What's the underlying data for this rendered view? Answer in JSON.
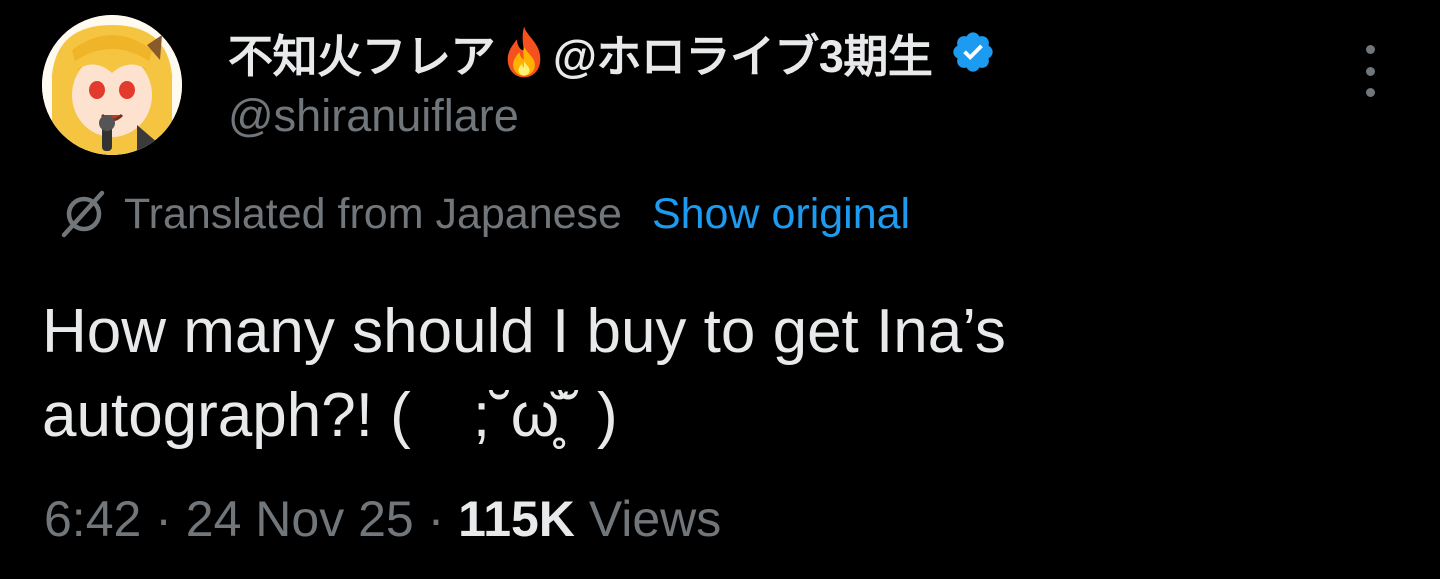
{
  "author": {
    "display_name": "不知火フレア",
    "display_name_suffix": "@ホロライブ3期生",
    "handle": "@shiranuiflare",
    "emoji_icon": "fire-icon",
    "verified_icon": "verified-badge-icon"
  },
  "translation": {
    "notice": "Translated from Japanese",
    "show_original_label": "Show original"
  },
  "tweet": {
    "text": "How many should I buy to get Ina’s\nautograph?! (　;˘ω̥̆˘ )"
  },
  "meta": {
    "time": "6:42",
    "separator_1": " · ",
    "date": "24 Nov 25",
    "separator_2": " · ",
    "views_count": "115K",
    "views_label": " Views"
  },
  "colors": {
    "background": "#000000",
    "primary_text": "#e7e9ea",
    "secondary_text": "#71767b",
    "accent": "#1d9bf0"
  }
}
